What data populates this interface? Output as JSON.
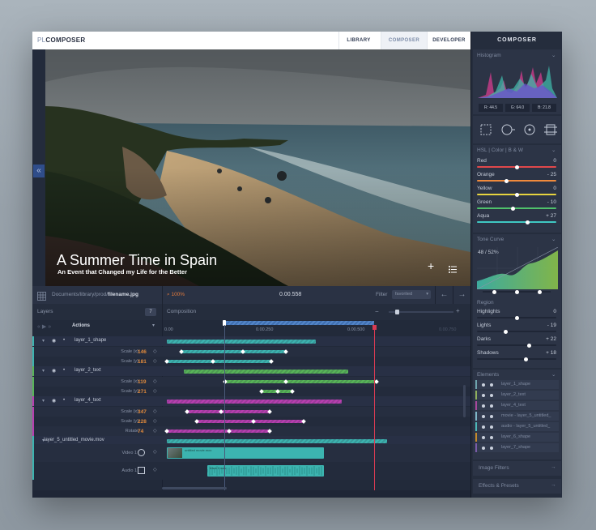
{
  "app": {
    "logo_pre": "PL",
    "logo_main": "COMPOSER"
  },
  "tabs": [
    {
      "label": "LIBRARY"
    },
    {
      "label": "COMPOSER"
    },
    {
      "label": "DEVELOPER"
    }
  ],
  "sidebar_title": "COMPOSER",
  "photo": {
    "title": "A Summer Time in Spain",
    "subtitle": "An Event that Changed my Life for the Better"
  },
  "pathbar": {
    "path": "Documents/library/prod/",
    "file": "filename.jpg",
    "zoom": "100%",
    "time": "0.00.558",
    "filter_label": "Filter",
    "filter_value": "favorited"
  },
  "layers": {
    "label": "Layers",
    "count": "7",
    "composition": "Composition",
    "actions": "Actions"
  },
  "ruler": [
    "0.00",
    "0.00.250",
    "0.00.500",
    "0.00.750"
  ],
  "tracks": [
    {
      "name": "layer_1_shape",
      "props": [
        {
          "label": "Scale (x)",
          "value": "146"
        },
        {
          "label": "Scale (y)",
          "value": "181"
        }
      ]
    },
    {
      "name": "layer_2_text",
      "props": [
        {
          "label": "Scale (x)",
          "value": "119"
        },
        {
          "label": "Scale (y)",
          "value": "271"
        }
      ]
    },
    {
      "name": "layer_4_text",
      "props": [
        {
          "label": "Scale (x)",
          "value": "347"
        },
        {
          "label": "Scale (y)",
          "value": "228"
        },
        {
          "label": "Rotate",
          "value": "74"
        }
      ]
    },
    {
      "name": "layer_5_untitled_movie.mov",
      "props": [
        {
          "label": "Video 1"
        },
        {
          "label": "Audio 1"
        }
      ]
    }
  ],
  "media_clips": {
    "video": "untitled movie.mov",
    "audio": "track 1 wav"
  },
  "histogram": {
    "label": "Histogram",
    "r": "R: 44.5",
    "g": "G: 64.0",
    "b": "B: 21.8"
  },
  "hsl": {
    "label": "HSL | Color | B & W",
    "items": [
      {
        "name": "Red",
        "value": "0",
        "level": 0.5,
        "color": "#e0484b"
      },
      {
        "name": "Orange",
        "value": "- 25",
        "level": 0.37,
        "color": "#f08a3c"
      },
      {
        "name": "Yellow",
        "value": "0",
        "level": 0.5,
        "color": "#e6d33f"
      },
      {
        "name": "Green",
        "value": "- 10",
        "level": 0.45,
        "color": "#4fc06b"
      },
      {
        "name": "Aqua",
        "value": "+ 27",
        "level": 0.64,
        "color": "#3fc7c2"
      }
    ]
  },
  "tone": {
    "label": "Tone Curve",
    "readout": "48 / 52%"
  },
  "region": {
    "label": "Region",
    "items": [
      {
        "name": "Highlights",
        "value": "0",
        "level": 0.5
      },
      {
        "name": "Lights",
        "value": "- 19",
        "level": 0.36
      },
      {
        "name": "Darks",
        "value": "+ 22",
        "level": 0.66
      },
      {
        "name": "Shadows",
        "value": "+ 18",
        "level": 0.62
      }
    ]
  },
  "elements": {
    "label": "Elements",
    "items": [
      "layer_1_shape",
      "layer_2_text",
      "layer_4_text",
      "movie - layer_5_untitled_",
      "audio - layer_5_untitled_",
      "layer_6_shape",
      "layer_7_shape"
    ],
    "colors": [
      "#6ea4ad",
      "#8fb05d",
      "#a8489d",
      "#7fb7c7",
      "#4db8b8",
      "#c48b2c",
      "#7a5ca8"
    ]
  },
  "panels": [
    {
      "label": "Image Filters"
    },
    {
      "label": "Effects & Presets"
    }
  ],
  "colors": {
    "teal": "#3cb4b0",
    "green": "#58b558",
    "magenta": "#b83fb0",
    "playhead": "#d83b53",
    "blue": "#3f6fb0"
  }
}
